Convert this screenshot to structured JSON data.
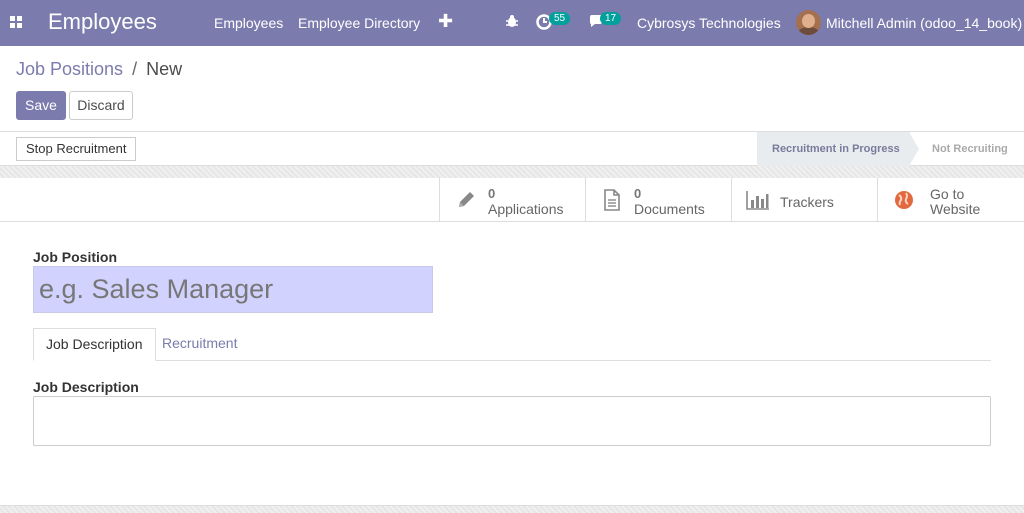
{
  "topbar": {
    "app_title": "Employees",
    "menu": [
      "Employees",
      "Employee Directory"
    ],
    "activity_count": "55",
    "message_count": "17",
    "company": "Cybrosys Technologies",
    "user": "Mitchell Admin (odoo_14_book)",
    "accent_color": "#7c7bad"
  },
  "breadcrumb": {
    "parent": "Job Positions",
    "separator": "/",
    "current": "New"
  },
  "actions": {
    "save": "Save",
    "discard": "Discard"
  },
  "statusbar": {
    "stop_button": "Stop Recruitment",
    "stages": [
      "Recruitment in Progress",
      "Not Recruiting"
    ],
    "active_stage": "Recruitment in Progress"
  },
  "smart_buttons": {
    "applications": {
      "count": "0",
      "label": "Applications",
      "icon": "pencil-icon"
    },
    "documents": {
      "count": "0",
      "label": "Documents",
      "icon": "document-icon"
    },
    "trackers": {
      "label": "Trackers",
      "icon": "bar-chart-icon"
    },
    "website": {
      "line1": "Go to",
      "line2": "Website",
      "icon": "globe-icon"
    }
  },
  "form": {
    "job_position_label": "Job Position",
    "job_position_placeholder": "e.g. Sales Manager",
    "tabs": [
      "Job Description",
      "Recruitment"
    ],
    "active_tab": "Job Description",
    "description_label": "Job Description",
    "description_value": ""
  }
}
